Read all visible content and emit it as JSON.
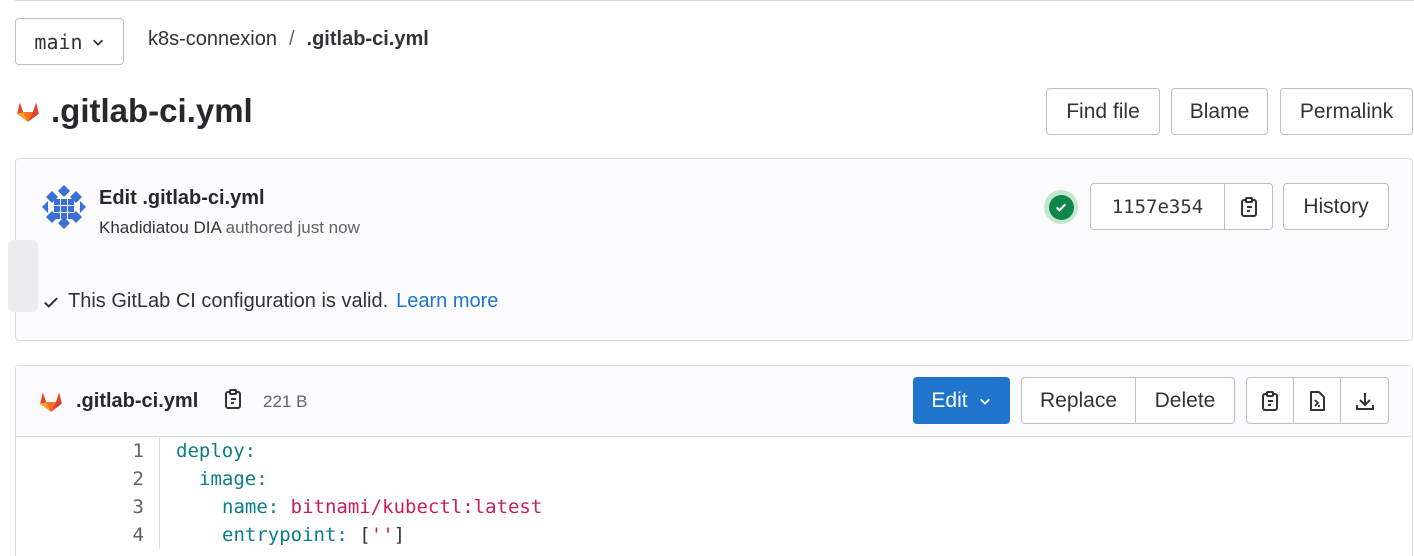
{
  "branch": {
    "label": "main"
  },
  "breadcrumb": {
    "project": "k8s-connexion",
    "separator": "/",
    "file": ".gitlab-ci.yml"
  },
  "page_title": ".gitlab-ci.yml",
  "header_actions": {
    "find_file": "Find file",
    "blame": "Blame",
    "permalink": "Permalink"
  },
  "commit": {
    "title": "Edit .gitlab-ci.yml",
    "author": "Khadidiatou DIA",
    "authored": "authored just now",
    "sha": "1157e354",
    "history_label": "History",
    "ci_message": "This GitLab CI configuration is valid.",
    "learn_more": "Learn more"
  },
  "file": {
    "name": ".gitlab-ci.yml",
    "size": "221 B",
    "edit_label": "Edit",
    "replace_label": "Replace",
    "delete_label": "Delete"
  },
  "code_lines": [
    {
      "n": "1",
      "key": "deploy:",
      "val": "",
      "indent": 0
    },
    {
      "n": "2",
      "key": "image:",
      "val": "",
      "indent": 1
    },
    {
      "n": "3",
      "key": "name:",
      "val": "bitnami/kubectl:latest",
      "indent": 2
    },
    {
      "n": "4",
      "key": "entrypoint:",
      "val": "['']",
      "indent": 2
    }
  ],
  "colors": {
    "accent": "#1f75cb",
    "success": "#108548",
    "code_key": "#0a7c8a",
    "code_string": "#c91c5a",
    "gitlab_orange": "#e24329"
  }
}
